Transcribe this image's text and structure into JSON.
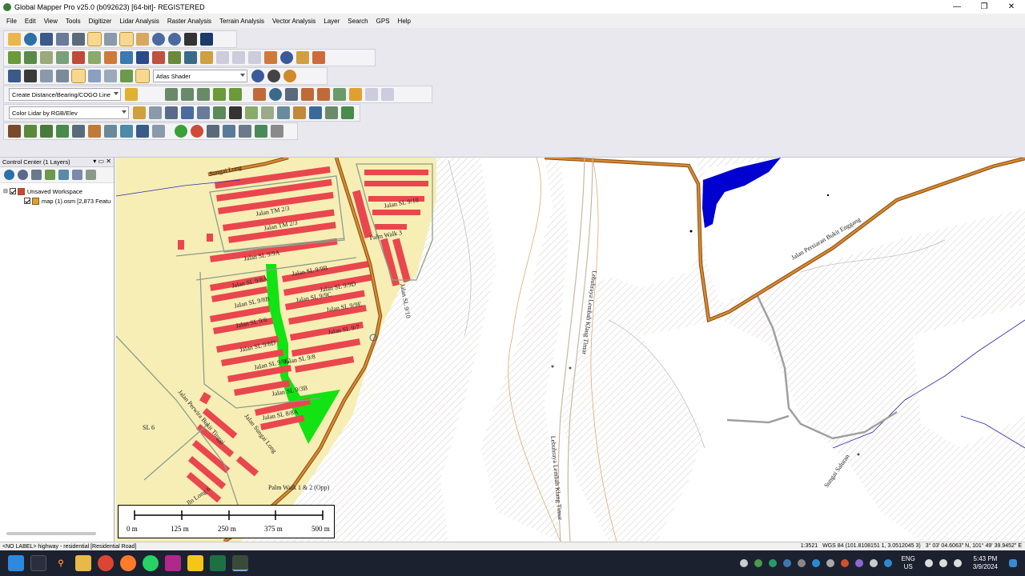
{
  "window": {
    "title": "Global Mapper Pro v25.0 (b092623) [64-bit]- REGISTERED"
  },
  "menu": [
    "File",
    "Edit",
    "View",
    "Tools",
    "Digitizer",
    "Lidar Analysis",
    "Raster Analysis",
    "Terrain Analysis",
    "Vector Analysis",
    "Layer",
    "Search",
    "GPS",
    "Help"
  ],
  "toolbar": {
    "shader_select": "Atlas Shader",
    "digitizer_select": "Create Distance/Bearing/COGO Line",
    "lidar_select": "Color Lidar by RGB/Elev"
  },
  "control_center": {
    "title": "Control Center (1 Layers)",
    "workspace": "Unsaved Workspace",
    "layer": "map (1).osm [2,873 Featu"
  },
  "map": {
    "labels": {
      "sungai_long": "Sungai Long",
      "jalan_tm23": "Jalan TM 2/3",
      "jalan_tm": "Jalan TM 2/3",
      "jalan_sl99a": "Jalan SL 9/9A",
      "jalan_sl910": "Jalan SL 9/10",
      "palm_walk3": "Palm Walk 3",
      "jalan_sl98a": "Jalan SL 9/8A",
      "jalan_sl99b": "Jalan SL 9/9B",
      "jalan_sl99d": "Jalan SL 9/9D",
      "jalan_sl98b": "Jalan SL 9/8B",
      "jalan_sl99c": "Jalan SL 9/9C",
      "jalan_sl99e": "Jalan SL 9/9E",
      "jalan_sl96": "Jalan SL 9/6",
      "jalan_sl97": "Jalan SL 9/7",
      "jalan_sl98d": "Jalan SL 9/8D",
      "jalan_sl98": "Jalan SL 9/8",
      "jalan_sl98c": "Jalan SL 9/8C",
      "jalan_sl9": "Jalan SL 9",
      "jalan_sl93b": "Jalan SL 9/3B",
      "jalan_sl98a2": "Jalan SL 8/8A",
      "sl6": "SL 6",
      "jalan_sl98b2": "Jalan SL 9/8B",
      "jalan_sl910b": "Jalan SL 9/10",
      "jalan_perwira": "Jalan Perwira Bukit Tinggi",
      "jalan_sungai_long": "Jalan Sungai Long",
      "palm_walk12": "Palm Walk 1 & 2 (Opp)",
      "jalan_long6": "Jln Long 6",
      "lebuhraya1": "Lebuhraya Lembah Klang Timur",
      "lebuhraya2": "Lebuhraya Lembah Klang Timur",
      "jalan_perpaduan": "Jalan Persiaran Bukit Enggang",
      "sungai_saluran": "Sungai Saluran"
    },
    "scale": {
      "ticks": [
        "0 m",
        "125 m",
        "250 m",
        "375 m",
        "500 m"
      ]
    }
  },
  "status": {
    "left": "<NO LABEL> highway - residential [Residential Road]",
    "scale": "1:3521",
    "coords": "WGS 84 (101.8108151 1, 3.0512045 3)",
    "dms": "3° 03' 04.6063\" N, 101° 49' 39.9452\" E"
  },
  "taskbar": {
    "lang": "ENG",
    "region": "US",
    "time": "5:43 PM",
    "date": "3/9/2024"
  },
  "colors": {
    "building": "#e9474d",
    "residential": "#f7eeb5",
    "park": "#12e312",
    "water": "#0000d0",
    "major_road": "#c06a10",
    "minor_road": "#8b9e8e"
  }
}
